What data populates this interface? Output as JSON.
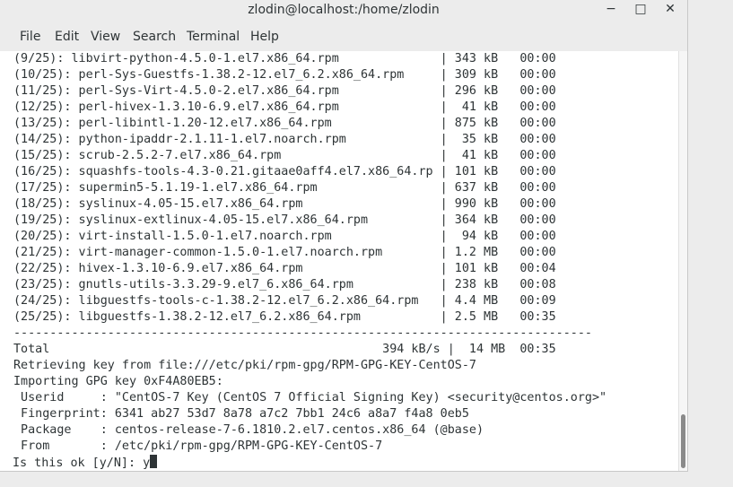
{
  "window": {
    "title": "zlodin@localhost:/home/zlodin",
    "minimize_label": "−",
    "maximize_label": "□",
    "close_label": "✕"
  },
  "menu": {
    "items": [
      "File",
      "Edit",
      "View",
      "Search",
      "Terminal",
      "Help"
    ]
  },
  "terminal": {
    "lines": [
      "(9/25): libvirt-python-4.5.0-1.el7.x86_64.rpm              | 343 kB   00:00",
      "(10/25): perl-Sys-Guestfs-1.38.2-12.el7_6.2.x86_64.rpm     | 309 kB   00:00",
      "(11/25): perl-Sys-Virt-4.5.0-2.el7.x86_64.rpm              | 296 kB   00:00",
      "(12/25): perl-hivex-1.3.10-6.9.el7.x86_64.rpm              |  41 kB   00:00",
      "(13/25): perl-libintl-1.20-12.el7.x86_64.rpm               | 875 kB   00:00",
      "(14/25): python-ipaddr-2.1.11-1.el7.noarch.rpm             |  35 kB   00:00",
      "(15/25): scrub-2.5.2-7.el7.x86_64.rpm                      |  41 kB   00:00",
      "(16/25): squashfs-tools-4.3-0.21.gitaae0aff4.el7.x86_64.rp | 101 kB   00:00",
      "(17/25): supermin5-5.1.19-1.el7.x86_64.rpm                 | 637 kB   00:00",
      "(18/25): syslinux-4.05-15.el7.x86_64.rpm                   | 990 kB   00:00",
      "(19/25): syslinux-extlinux-4.05-15.el7.x86_64.rpm          | 364 kB   00:00",
      "(20/25): virt-install-1.5.0-1.el7.noarch.rpm               |  94 kB   00:00",
      "(21/25): virt-manager-common-1.5.0-1.el7.noarch.rpm        | 1.2 MB   00:00",
      "(22/25): hivex-1.3.10-6.9.el7.x86_64.rpm                   | 101 kB   00:04",
      "(23/25): gnutls-utils-3.3.29-9.el7_6.x86_64.rpm            | 238 kB   00:08",
      "(24/25): libguestfs-tools-c-1.38.2-12.el7_6.2.x86_64.rpm   | 4.4 MB   00:09",
      "(25/25): libguestfs-1.38.2-12.el7_6.2.x86_64.rpm           | 2.5 MB   00:35",
      "--------------------------------------------------------------------------------",
      "Total                                              394 kB/s |  14 MB  00:35",
      "Retrieving key from file:///etc/pki/rpm-gpg/RPM-GPG-KEY-CentOS-7",
      "Importing GPG key 0xF4A80EB5:",
      " Userid     : \"CentOS-7 Key (CentOS 7 Official Signing Key) <security@centos.org>\"",
      " Fingerprint: 6341 ab27 53d7 8a78 a7c2 7bb1 24c6 a8a7 f4a8 0eb5",
      " Package    : centos-release-7-6.1810.2.el7.centos.x86_64 (@base)",
      " From       : /etc/pki/rpm-gpg/RPM-GPG-KEY-CentOS-7"
    ],
    "prompt": "Is this ok [y/N]: ",
    "input": "y"
  }
}
